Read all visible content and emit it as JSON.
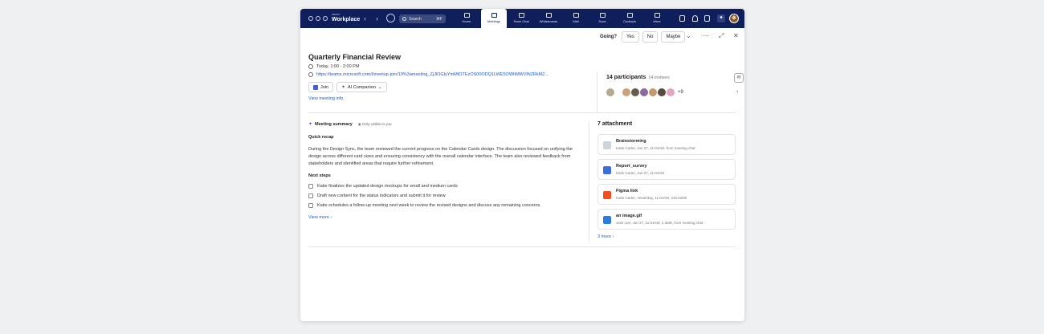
{
  "app": {
    "brand_small": "zoom",
    "brand": "Workplace"
  },
  "search": {
    "placeholder": "Search",
    "shortcut": "⌘F"
  },
  "nav": [
    {
      "label": "Home",
      "icon": "home-icon"
    },
    {
      "label": "Meetings",
      "icon": "calendar-icon",
      "active": true
    },
    {
      "label": "Team Chat",
      "icon": "chat-icon"
    },
    {
      "label": "Whiteboards",
      "icon": "whiteboard-icon"
    },
    {
      "label": "Mail",
      "icon": "mail-icon"
    },
    {
      "label": "Docs",
      "icon": "docs-icon"
    },
    {
      "label": "Contacts",
      "icon": "contacts-icon"
    },
    {
      "label": "More",
      "icon": "more-icon"
    }
  ],
  "going": {
    "label": "Going?",
    "yes": "Yes",
    "no": "No",
    "maybe": "Maybe"
  },
  "meeting": {
    "title": "Quarterly Financial Review",
    "time": "Today, 1:00 - 2:00 PM",
    "url": "https://teams.microsoft.com/l/meetup-join/19%3ameeting_ZjJlOGIyYmMtOTEzOS00ODQ1LWE5OWItMWVlN2RkM2...",
    "join_label": "Join",
    "ai_label": "AI Companion",
    "view_info": "View meeting info"
  },
  "participants": {
    "title": "14 participants",
    "invitees": "14 invitees",
    "more": "+9"
  },
  "summary": {
    "title": "Meeting summary",
    "visibility": "Only visible to you",
    "recap_title": "Quick recap",
    "recap": "During the Design Sync, the team reviewed the current progress on the Calendar Cards design. The discussion focused on unifying the design across different card sizes and ensuring consistency with the overall calendar interface. The team also reviewed feedback from stakeholders and identified areas that require further refinement.",
    "next_title": "Next steps",
    "steps": [
      "Katie finalizes the updated design mockups for small and medium cards",
      "Draft new content for the status indicators and submit it for review",
      "Katie schedules a follow-up meeting next week to review the revised designs and discuss any remaining concerns."
    ],
    "view_more": "View more"
  },
  "attachments": {
    "title": "7 attachment",
    "items": [
      {
        "name": "Brainstorming",
        "meta": "Katie Carter, Jun 27, 11:04AM, from meeting chat",
        "color": "#cfd3da"
      },
      {
        "name": "Report_survey",
        "meta": "Katie Carter, Jun 27, 11:04AM",
        "color": "#3b6fe0"
      },
      {
        "name": "Figma link",
        "meta": "Katie Carter, Yesterday, 11:04AM, 415.02KB",
        "color": "#f24e1e"
      },
      {
        "name": "an image.gif",
        "meta": "Jack Lee, Jun 27, 11:04AM, 1.3MB, from meeting chat",
        "color": "#2a7de1"
      }
    ],
    "more": "3 more"
  }
}
